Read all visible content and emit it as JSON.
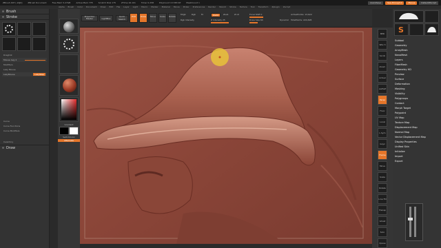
{
  "titlebar": {
    "app": "ZBrush 4R7 [-k4J6]",
    "document": "ZBrush Document",
    "free_mem": "Free Mem 5.27GB",
    "active_mem": "Active Mem 778",
    "scratch_disk": "Scratch Disk 175",
    "ztime": "ZTime 16.101",
    "timer": "Timer 0.258",
    "poly_count": "PolyCount 13.583 KP",
    "mesh_count": "MeshCount 1",
    "quicksave": "QuickSave",
    "see_through": "See-through 0",
    "menus": "Menus",
    "default_zscript": "DefaultZScript"
  },
  "menubar": [
    "Alpha",
    "Brush",
    "Color",
    "Document",
    "Draw",
    "Edit",
    "File",
    "Layer",
    "Light",
    "Macro",
    "Marker",
    "Material",
    "Movie",
    "Picker",
    "Preferences",
    "Render",
    "Stencil",
    "Stroke",
    "Texture",
    "Tool",
    "Transform",
    "Zplugin",
    "Zscript"
  ],
  "leftpanel": {
    "brush_header": "Brush",
    "stroke_header": "Stroke",
    "brush_name": "DragDot",
    "mouse_avg": "Mouse Avg 4",
    "modifiers": "Modifiers",
    "lazy_mouse": "Lazy Mouse",
    "lazy_mouse_label": "LazyMouse",
    "lazy_step": "LazyStep",
    "curve": "Curve",
    "curve_functions": "Curve Functions",
    "curve_modifiers": "Curve Modifiers",
    "inventory": "Inventory",
    "draw_header": "Draw"
  },
  "tray": {
    "projection_master": "Projection Master",
    "lightbox": "LightBox",
    "gradient": "Gradient",
    "switch_color": "SwitchColor",
    "alternate": "Alternate"
  },
  "toolbar": {
    "quick_sketch": "Quick Sketch",
    "edit": "Edit",
    "draw": "Draw",
    "move": "Move",
    "scale": "Scale",
    "rotate": "Rotate",
    "mrgb": "Mrgb",
    "rgb": "Rgb",
    "m": "M",
    "rgb_intensity": "Rgb Intensity",
    "zadd": "Zadd",
    "zsub": "Zsub",
    "zcut": "Zcut",
    "z_intensity": "Z Intensity 25",
    "focal_shift": "Focal Shift 0",
    "draw_size": "Draw Size 64",
    "dynamic": "Dynamic",
    "active_points": "ActivePoints: 13,622",
    "total_points": "TotalPoints: 224,695"
  },
  "rightshelf": [
    "BPR",
    "SPix 3",
    "Scroll",
    "Zoom",
    "Actual",
    "AAHalf",
    "Persp",
    "Floor",
    "Local",
    "L.Sym",
    "Gxyz",
    "Frame",
    "Move",
    "Scale",
    "Rotate",
    "Line Fill",
    "Transp",
    "Ghost",
    "Solo",
    "Xpose"
  ],
  "rightpanel": {
    "menu_items": [
      "Subtool",
      "Geometry",
      "ArrayMesh",
      "NanoMesh",
      "Layers",
      "FiberMesh",
      "Geometry HD",
      "Preview",
      "Surface",
      "Deformation",
      "Masking",
      "Visibility",
      "Polygroups",
      "Contact",
      "Morph Target",
      "Polypaint",
      "UV Map",
      "Texture Map",
      "Displacement Map",
      "Normal Map",
      "Vector Displacement Map",
      "Display Properties",
      "Unified Skin",
      "Initialize",
      "Import",
      "Export"
    ]
  },
  "colors": {
    "accent": "#e5762a",
    "clay": "#8e4a3d",
    "panel": "#333333"
  }
}
